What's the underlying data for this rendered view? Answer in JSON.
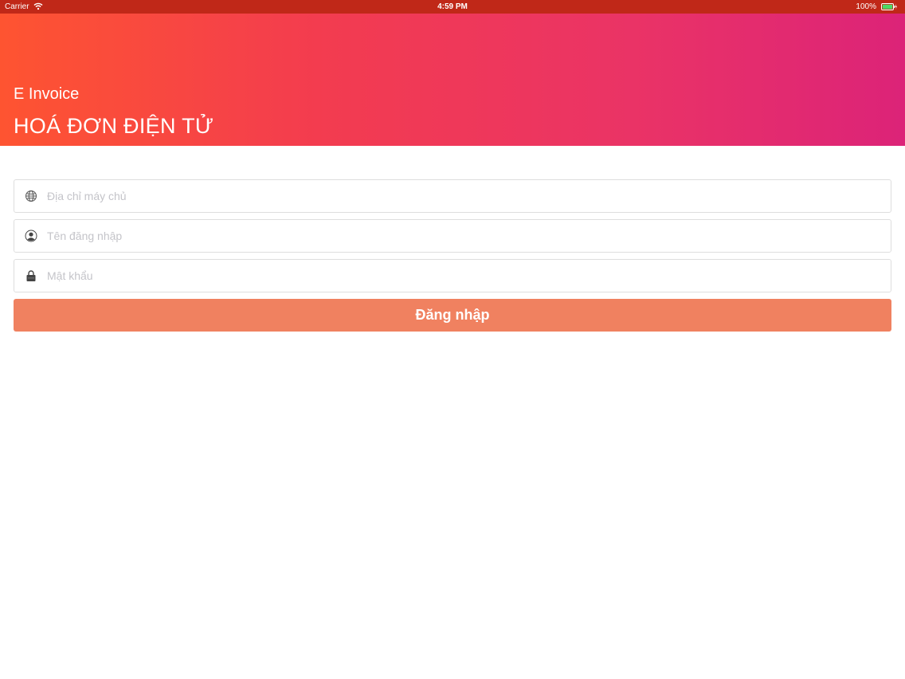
{
  "status_bar": {
    "carrier": "Carrier",
    "time": "4:59 PM",
    "battery_percent": "100%",
    "battery_level": 1.0,
    "icons": [
      "wifi-icon",
      "battery-icon",
      "charging-icon"
    ]
  },
  "header": {
    "subtitle": "E Invoice",
    "title": "HOÁ ĐƠN ĐIỆN TỬ",
    "gradient": [
      "#fe5431",
      "#dc2378"
    ]
  },
  "form": {
    "server": {
      "icon": "globe-icon",
      "value": "",
      "placeholder": "Địa chỉ máy chủ"
    },
    "username": {
      "icon": "user-icon",
      "value": "",
      "placeholder": "Tên đăng nhập"
    },
    "password": {
      "icon": "lock-icon",
      "value": "",
      "placeholder": "Mật khẩu"
    },
    "login_label": "Đăng nhập"
  },
  "colors": {
    "status_bar": "#c02818",
    "accent_button": "#f08160",
    "field_border": "#dedede",
    "placeholder": "#c4c4c9"
  }
}
